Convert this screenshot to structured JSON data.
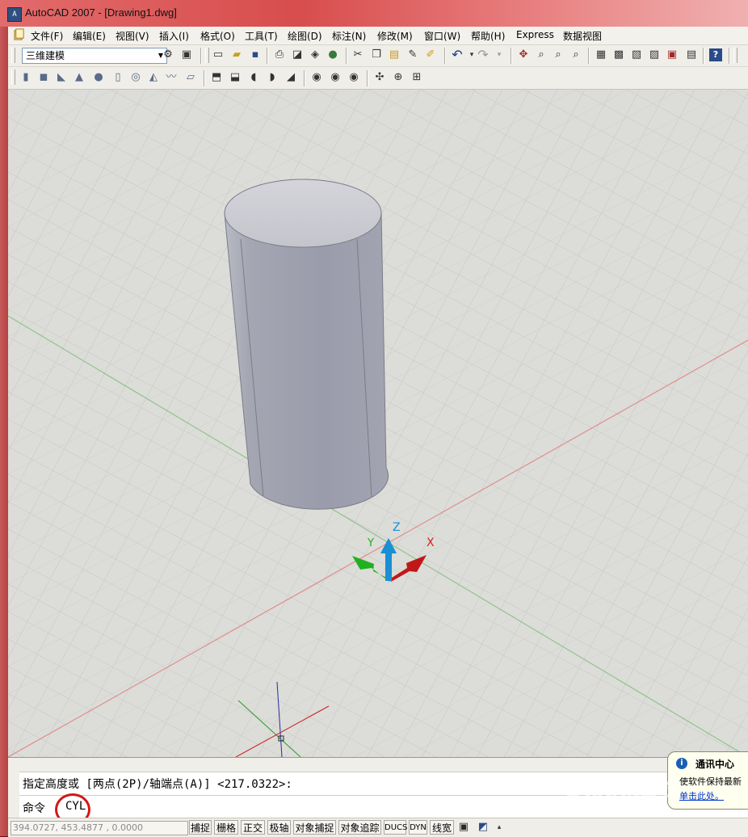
{
  "window": {
    "title": "AutoCAD 2007 - [Drawing1.dwg]",
    "app_icon": "acad-icon"
  },
  "menubar": {
    "items": [
      "文件(F)",
      "编辑(E)",
      "视图(V)",
      "插入(I)",
      "格式(O)",
      "工具(T)",
      "绘图(D)",
      "标注(N)",
      "修改(M)",
      "窗口(W)",
      "帮助(H)",
      "Express",
      "数据视图"
    ]
  },
  "toolbar1": {
    "workspace": "三维建模"
  },
  "viewport": {
    "ucs_labels": {
      "x": "X",
      "y": "Y",
      "z": "Z"
    },
    "colors": {
      "x_axis": "#d42020",
      "y_axis": "#20b020",
      "z_axis": "#1a8fd4",
      "background": "#dcdcd8",
      "grid": "#c8c8c4"
    }
  },
  "command": {
    "prompt": "指定高度或 [两点(2P)/轴端点(A)] <217.0322>:",
    "label": "命令",
    "input_value": "CYL"
  },
  "statusbar": {
    "coords": "394.0727,  453.4877 , 0.0000",
    "buttons": [
      "捕捉",
      "栅格",
      "正交",
      "极轴",
      "对象捕捉",
      "对象追踪",
      "DUCS",
      "DYN",
      "线宽"
    ]
  },
  "notification": {
    "title": "通讯中心",
    "message": "使软件保持最新",
    "link": "单击此处。"
  },
  "watermark": {
    "text": "Baidu经验",
    "sub": "jingyan.baidu.com"
  }
}
